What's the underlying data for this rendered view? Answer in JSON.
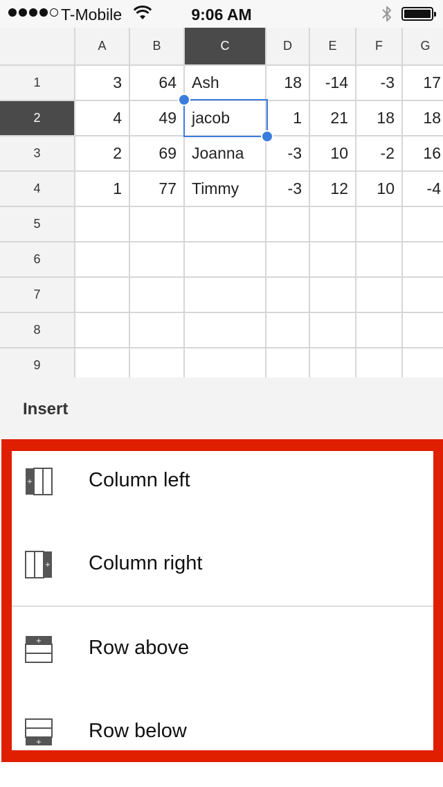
{
  "status_bar": {
    "carrier": "T-Mobile",
    "time": "9:06 AM",
    "signal_bars": 4,
    "signal_max": 5
  },
  "spreadsheet": {
    "columns": [
      "A",
      "B",
      "C",
      "D",
      "E",
      "F",
      "G"
    ],
    "selected_column": "C",
    "rows": [
      {
        "label": "1",
        "cells": [
          "3",
          "64",
          "Ash",
          "18",
          "-14",
          "-3",
          "17"
        ]
      },
      {
        "label": "2",
        "cells": [
          "4",
          "49",
          "jacob",
          "1",
          "21",
          "18",
          "18"
        ]
      },
      {
        "label": "3",
        "cells": [
          "2",
          "69",
          "Joanna",
          "-3",
          "10",
          "-2",
          "16"
        ]
      },
      {
        "label": "4",
        "cells": [
          "1",
          "77",
          "Timmy",
          "-3",
          "12",
          "10",
          "-4"
        ]
      },
      {
        "label": "5",
        "cells": [
          "",
          "",
          "",
          "",
          "",
          "",
          ""
        ]
      },
      {
        "label": "6",
        "cells": [
          "",
          "",
          "",
          "",
          "",
          "",
          ""
        ]
      },
      {
        "label": "7",
        "cells": [
          "",
          "",
          "",
          "",
          "",
          "",
          ""
        ]
      },
      {
        "label": "8",
        "cells": [
          "",
          "",
          "",
          "",
          "",
          "",
          ""
        ]
      },
      {
        "label": "9",
        "cells": [
          "",
          "",
          "",
          "",
          "",
          "",
          ""
        ]
      }
    ],
    "selected_row": "2",
    "selected_cell": "C2"
  },
  "insert_menu": {
    "title": "Insert",
    "items": [
      {
        "label": "Column left",
        "icon": "insert-column-left-icon"
      },
      {
        "label": "Column right",
        "icon": "insert-column-right-icon"
      },
      {
        "label": "Row above",
        "icon": "insert-row-above-icon"
      },
      {
        "label": "Row below",
        "icon": "insert-row-below-icon"
      }
    ]
  },
  "colors": {
    "accent": "#3b7ddd",
    "header_selected": "#4a4a4a",
    "highlight_frame": "#e01e00"
  }
}
